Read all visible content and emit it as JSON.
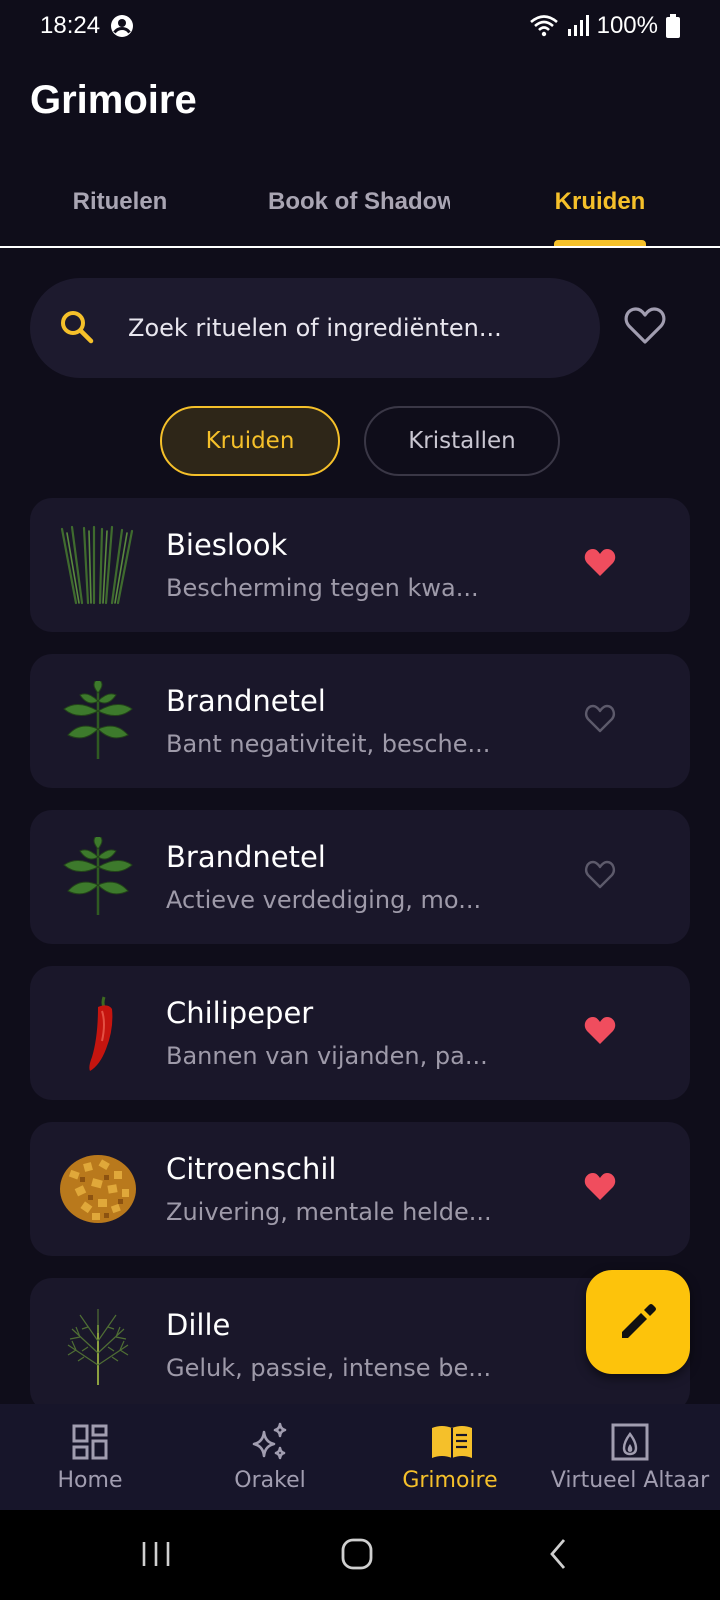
{
  "status_bar": {
    "time": "18:24",
    "battery": "100%",
    "icons": [
      "account-circle-icon",
      "wifi-icon",
      "signal-icon",
      "battery-icon"
    ]
  },
  "app": {
    "title": "Grimoire"
  },
  "tabs": [
    {
      "label": "Rituelen",
      "active": false
    },
    {
      "label": "Book of Shadows",
      "active": false
    },
    {
      "label": "Kruiden",
      "active": true
    }
  ],
  "search": {
    "placeholder": "Zoek rituelen of ingrediënten..."
  },
  "chips": [
    {
      "label": "Kruiden",
      "selected": true
    },
    {
      "label": "Kristallen",
      "selected": false
    }
  ],
  "items": [
    {
      "name": "Bieslook",
      "description": "Bescherming tegen kwa...",
      "favorite": true,
      "image": "chives"
    },
    {
      "name": "Brandnetel",
      "description": "Bant negativiteit, besche...",
      "favorite": false,
      "image": "nettle"
    },
    {
      "name": "Brandnetel",
      "description": "Actieve verdediging, mo...",
      "favorite": false,
      "image": "nettle"
    },
    {
      "name": "Chilipeper",
      "description": "Bannen van vijanden, pa...",
      "favorite": true,
      "image": "chili"
    },
    {
      "name": "Citroenschil",
      "description": "Zuivering, mentale helde...",
      "favorite": true,
      "image": "lemon-peel"
    },
    {
      "name": "Dille",
      "description": "Geluk, passie, intense be...",
      "favorite": false,
      "image": "dill"
    }
  ],
  "bottom_nav": [
    {
      "label": "Home",
      "icon": "dashboard-icon",
      "active": false
    },
    {
      "label": "Orakel",
      "icon": "sparkles-icon",
      "active": false
    },
    {
      "label": "Grimoire",
      "icon": "book-icon",
      "active": true
    },
    {
      "label": "Virtueel Altaar",
      "icon": "fireplace-icon",
      "active": false
    }
  ],
  "colors": {
    "background": "#0f0d1a",
    "card": "#1a172a",
    "accent": "#f5c02a",
    "fab": "#fdc30b",
    "heart": "#f04d5e"
  }
}
